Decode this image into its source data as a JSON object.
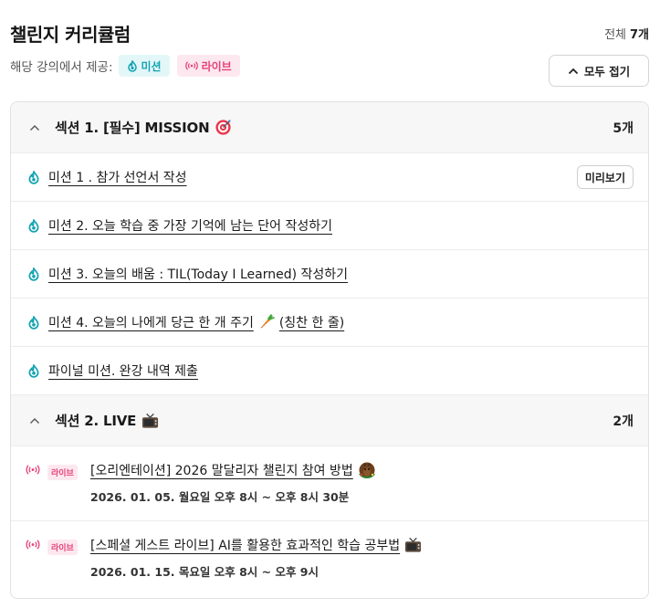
{
  "header": {
    "title": "챌린지 커리큘럼",
    "total_label": "전체",
    "total_count": "7개",
    "provided_label": "해당 강의에서 제공:",
    "chip_mission": "미션",
    "chip_live": "라이브",
    "collapse_all": "모두 접기"
  },
  "sections": [
    {
      "title": "섹션 1. [필수] MISSION",
      "count": "5개",
      "emoji": "target-icon",
      "lessons": [
        {
          "title": "미션 1 . 참가 선언서 작성",
          "preview": "미리보기"
        },
        {
          "title": "미션 2. 오늘 학습 중 가장 기억에 남는 단어 작성하기"
        },
        {
          "title": "미션 3. 오늘의 배움 : TIL(Today I Learned) 작성하기"
        },
        {
          "title": "미션 4. 오늘의 나에게 당근 한 개 주기",
          "title_suffix": "(칭찬 한 줄)",
          "emoji": "carrot-icon"
        },
        {
          "title": "파이널 미션. 완강 내역 제출"
        }
      ]
    },
    {
      "title": "섹션 2. LIVE",
      "count": "2개",
      "emoji": "tv-icon",
      "lives": [
        {
          "tag": "라이브",
          "title": "[오리엔테이션] 2026 말달리자 챌린지 참여 방법",
          "date": "2026. 01. 05. 월요일 오후 8시 ~ 오후 8시 30분",
          "emoji": "horse-icon"
        },
        {
          "tag": "라이브",
          "title": "[스페셜 게스트 라이브] AI를 활용한 효과적인 학습 공부법",
          "date": "2026. 01. 15. 목요일 오후 8시 ~ 오후 9시",
          "emoji": "tv-icon"
        }
      ]
    }
  ],
  "colors": {
    "mission_accent": "#13a3b3",
    "live_accent": "#e6407a",
    "section_bg": "#f7f7f7",
    "border": "#e2e2e2"
  }
}
